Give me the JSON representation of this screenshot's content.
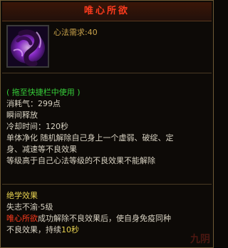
{
  "tooltip": {
    "title": "唯心所欲",
    "icon": "purple-spirit-icon",
    "requirement": "心法需求:40",
    "usage_hint": "( 拖至快捷栏中使用 )",
    "stats": [
      "消耗气：299点",
      "瞬间释放",
      "冷却时间：120秒"
    ],
    "description": [
      "单体净化 随机解除自己身上一个虚弱、破绽、定",
      "身、减速等不良效果",
      "等级高于自己心法等级的不良效果不能解除"
    ],
    "unique_effect_title": "绝学效果",
    "unique_effect_level": "失志不渝·5级",
    "effect_line1_skill": "唯心所欲",
    "effect_line1_rest": "成功解除不良效果后，使自身免疫同种",
    "effect_line2_prefix": "不良效果，持续",
    "effect_line2_value": "10秒",
    "watermark": "九阴"
  },
  "colors": {
    "title": "#ff3b1e",
    "requirement": "#c9a24a",
    "usage_hint": "#36d13a",
    "unique_title": "#e8d250"
  }
}
